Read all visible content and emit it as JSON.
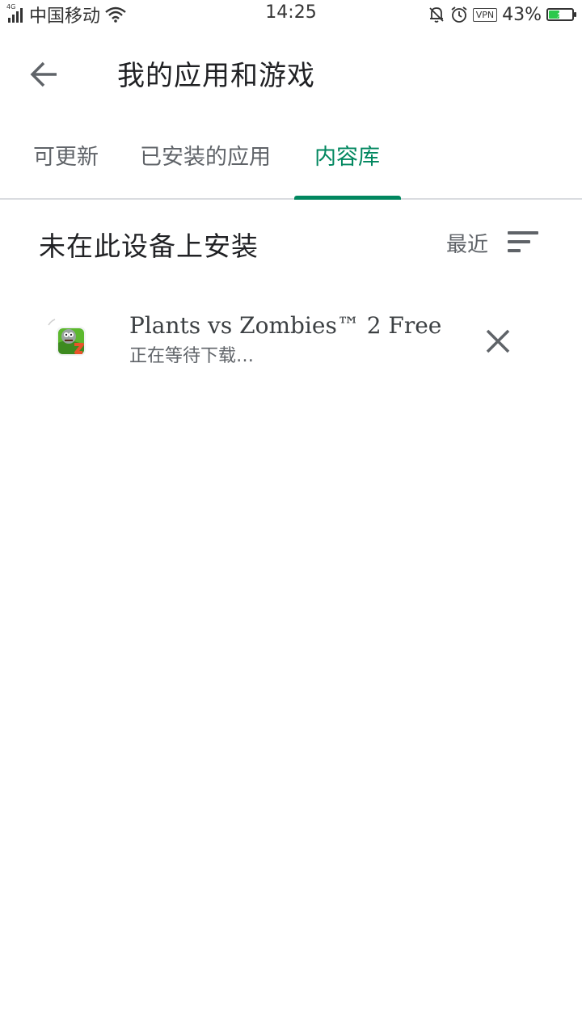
{
  "status_bar": {
    "network": "4G",
    "carrier": "中国移动",
    "time": "14:25",
    "vpn": "VPN",
    "battery": "43%",
    "battery_level": 0.43,
    "icons": [
      "signal-icon",
      "wifi-icon",
      "mute-bell-icon",
      "alarm-icon",
      "vpn-icon",
      "battery-icon"
    ]
  },
  "header": {
    "title": "我的应用和游戏",
    "back_icon": "arrow-back-icon"
  },
  "tabs": [
    {
      "label": "可更新",
      "active": false
    },
    {
      "label": "已安装的应用",
      "active": false
    },
    {
      "label": "内容库",
      "active": true
    }
  ],
  "section": {
    "title": "未在此设备上安装",
    "sort_label": "最近",
    "sort_icon": "sort-icon"
  },
  "apps": [
    {
      "name": "Plants vs Zombies™ 2 Free",
      "status": "正在等待下载…",
      "icon": "pvz2-app-icon",
      "remove_icon": "close-icon"
    }
  ],
  "colors": {
    "accent": "#01875f",
    "text_primary": "#202124",
    "text_secondary": "#5f6368",
    "divider": "#dadce0"
  }
}
